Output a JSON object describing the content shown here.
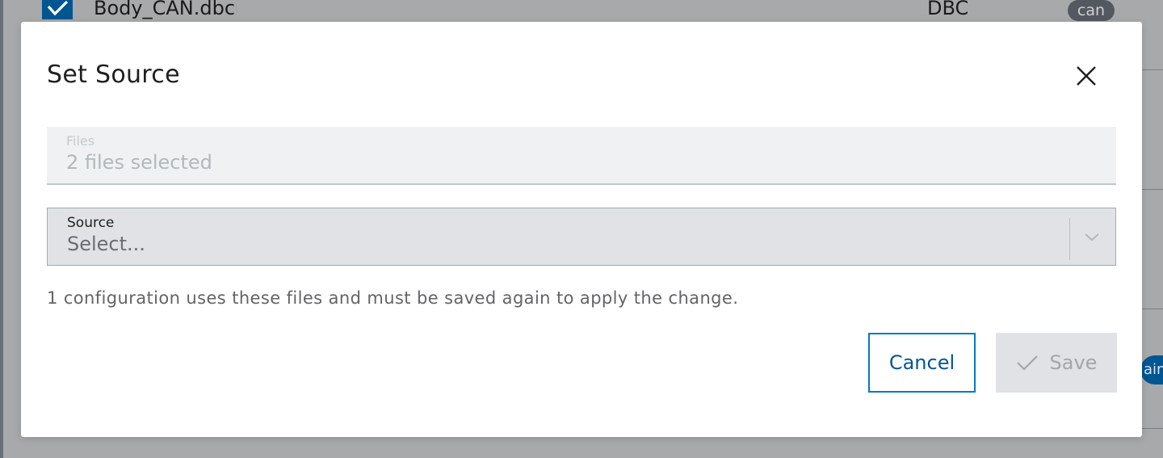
{
  "background": {
    "row": {
      "filename": "Body_CAN.dbc",
      "type": "DBC",
      "tag": "can",
      "checked": true
    },
    "pill_label": "ain"
  },
  "modal": {
    "title": "Set Source",
    "files": {
      "label": "Files",
      "value": "2 files selected"
    },
    "source": {
      "label": "Source",
      "placeholder": "Select..."
    },
    "info_text": "1 configuration uses these files and must be saved again to apply the change.",
    "buttons": {
      "cancel": "Cancel",
      "save": "Save"
    }
  },
  "colors": {
    "primary": "#007bc0",
    "primary_dark": "#005691",
    "overlay": "#a8a9ab",
    "disabled_bg": "#e0e2e5",
    "disabled_text": "#a2a6aa"
  }
}
